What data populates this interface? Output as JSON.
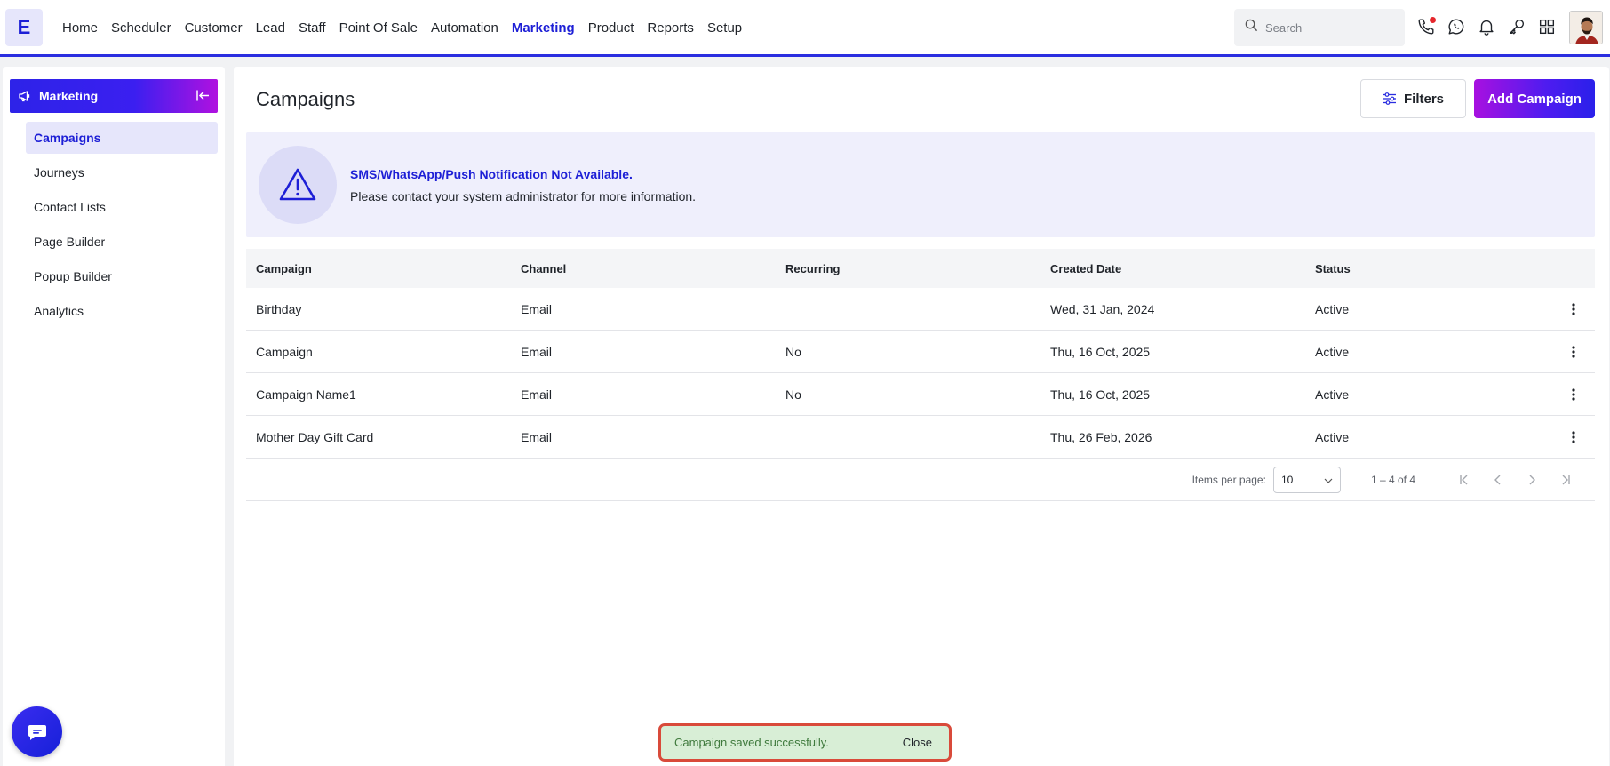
{
  "brand": {
    "logo_letter": "E"
  },
  "nav": {
    "items": [
      "Home",
      "Scheduler",
      "Customer",
      "Lead",
      "Staff",
      "Point Of Sale",
      "Automation",
      "Marketing",
      "Product",
      "Reports",
      "Setup"
    ],
    "active": "Marketing"
  },
  "search": {
    "placeholder": "Search"
  },
  "top_icons": [
    "phone-icon",
    "whatsapp-icon",
    "bell-icon",
    "key-icon",
    "apps-grid-icon"
  ],
  "colors": {
    "accent": "#1d1fd6",
    "notification_dot": "#e5262c",
    "toast_bg": "#d8eed6",
    "toast_border": "#d94a3a"
  },
  "sidebar": {
    "title": "Marketing",
    "items": [
      {
        "label": "Campaigns",
        "active": true
      },
      {
        "label": "Journeys",
        "active": false
      },
      {
        "label": "Contact Lists",
        "active": false
      },
      {
        "label": "Page Builder",
        "active": false
      },
      {
        "label": "Popup Builder",
        "active": false
      },
      {
        "label": "Analytics",
        "active": false
      }
    ]
  },
  "main": {
    "title": "Campaigns",
    "filters_label": "Filters",
    "add_label": "Add Campaign",
    "alert": {
      "title": "SMS/WhatsApp/Push Notification Not Available.",
      "text": "Please contact your system administrator for more information."
    },
    "table": {
      "headers": [
        "Campaign",
        "Channel",
        "Recurring",
        "Created Date",
        "Status"
      ],
      "rows": [
        {
          "campaign": "Birthday",
          "channel": "Email",
          "recurring": "",
          "created": "Wed, 31 Jan, 2024",
          "status": "Active"
        },
        {
          "campaign": "Campaign",
          "channel": "Email",
          "recurring": "No",
          "created": "Thu, 16 Oct, 2025",
          "status": "Active"
        },
        {
          "campaign": "Campaign Name1",
          "channel": "Email",
          "recurring": "No",
          "created": "Thu, 16 Oct, 2025",
          "status": "Active"
        },
        {
          "campaign": "Mother Day Gift Card",
          "channel": "Email",
          "recurring": "",
          "created": "Thu, 26 Feb, 2026",
          "status": "Active"
        }
      ]
    },
    "pagination": {
      "items_per_page_label": "Items per page:",
      "items_per_page": "10",
      "range": "1 – 4 of 4"
    }
  },
  "toast": {
    "message": "Campaign saved successfully.",
    "close_label": "Close"
  }
}
